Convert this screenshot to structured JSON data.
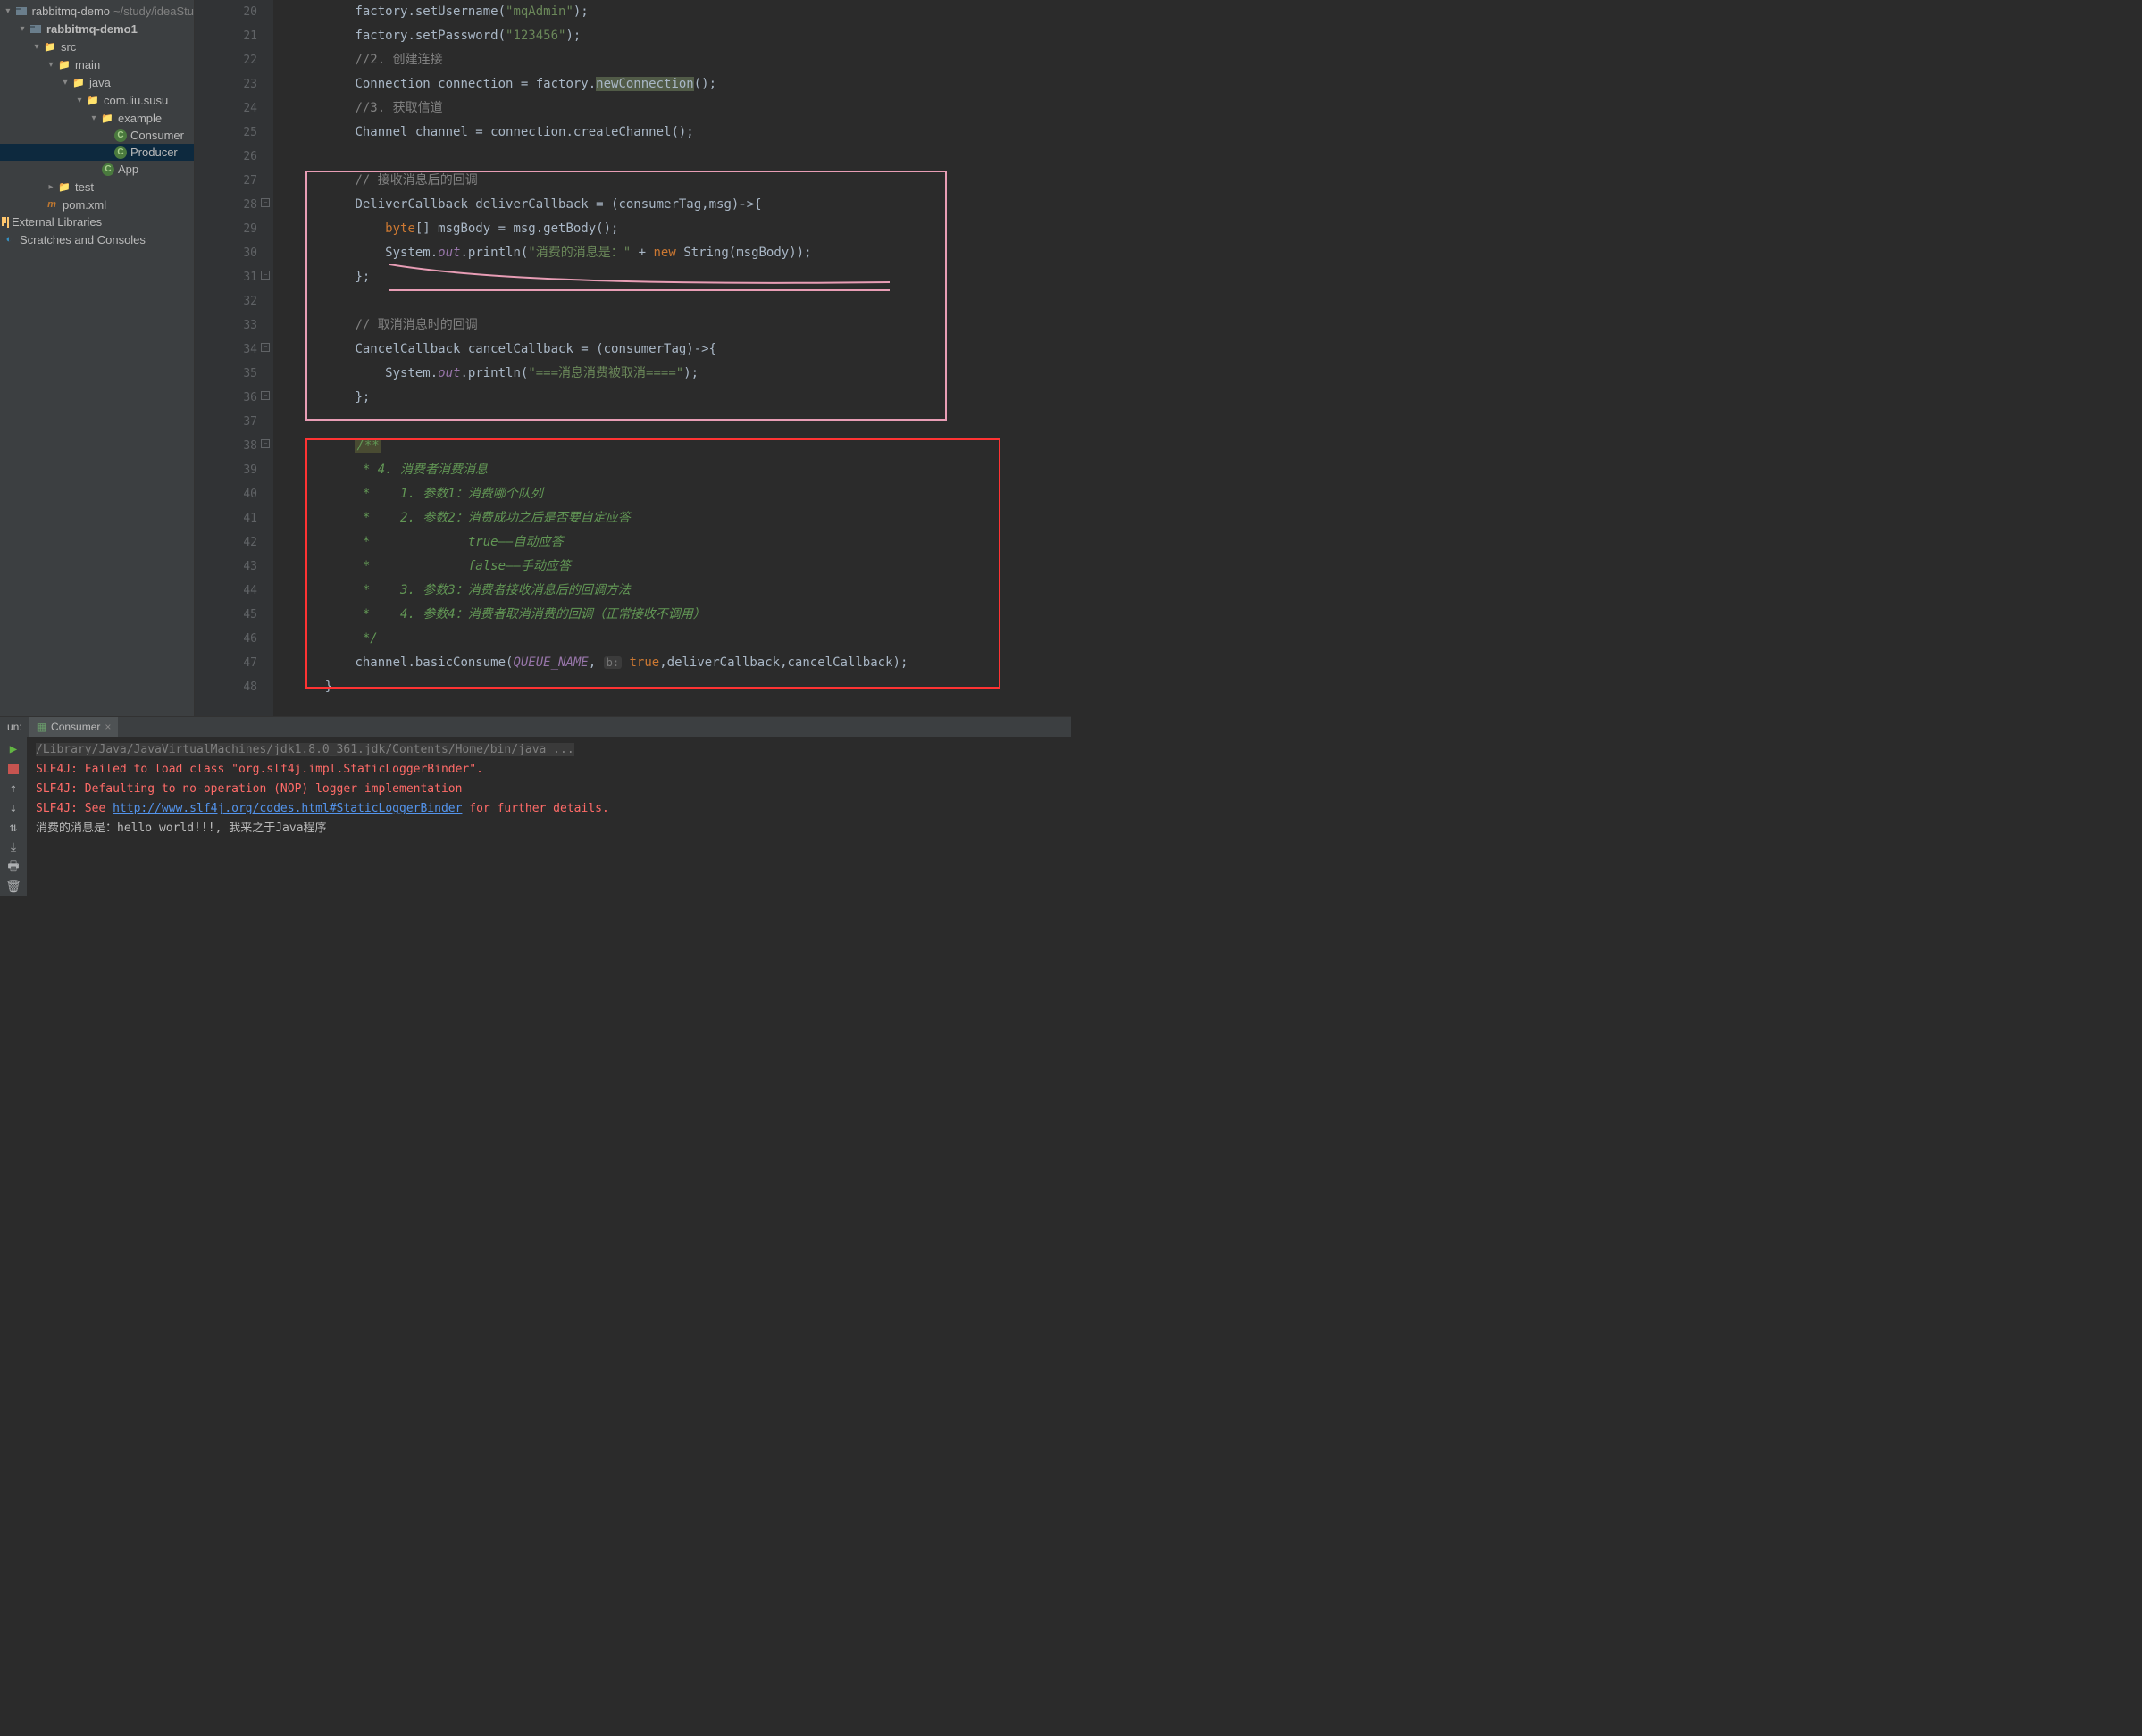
{
  "project": {
    "root": {
      "name": "rabbitmq-demo",
      "path": "~/study/ideaStu"
    },
    "module": "rabbitmq-demo1",
    "src": "src",
    "main": "main",
    "java": "java",
    "pkg": "com.liu.susu",
    "example": "example",
    "classes": {
      "consumer": "Consumer",
      "producer": "Producer",
      "app": "App"
    },
    "test": "test",
    "pom": "pom.xml",
    "extlib": "External Libraries",
    "scratches": "Scratches and Consoles"
  },
  "gutter": {
    "start": 20,
    "end": 48
  },
  "code": {
    "l20a": "factory.setUsername(",
    "l20b": "\"mqAdmin\"",
    "l20c": ");",
    "l21a": "factory.setPassword(",
    "l21b": "\"123456\"",
    "l21c": ");",
    "l22": "//2. 创建连接",
    "l23a": "Connection connection = factory.",
    "l23b": "newConnection",
    "l23c": "();",
    "l24": "//3. 获取信道",
    "l25": "Channel channel = connection.createChannel();",
    "l27": "// 接收消息后的回调",
    "l28": "DeliverCallback deliverCallback = (consumerTag,msg)->{",
    "l29a": "byte",
    "l29b": "[] msgBody = msg.getBody();",
    "l30a": "System.",
    "l30b": "out",
    "l30c": ".println(",
    "l30d": "\"消费的消息是：\"",
    "l30e": " + ",
    "l30f": "new",
    "l30g": " String(msgBody));",
    "l31": "};",
    "l33": "// 取消消息时的回调",
    "l34": "CancelCallback cancelCallback = (consumerTag)->{",
    "l35a": "System.",
    "l35b": "out",
    "l35c": ".println(",
    "l35d": "\"===消息消费被取消====\"",
    "l35e": ");",
    "l36": "};",
    "l38": "/**",
    "l39": " * 4. 消费者消费消息",
    "l40": " *    1. 参数1：消费哪个队列",
    "l41": " *    2. 参数2：消费成功之后是否要自定应答",
    "l42": " *             true——自动应答",
    "l43": " *             false——手动应答",
    "l44": " *    3. 参数3：消费者接收消息后的回调方法",
    "l45": " *    4. 参数4：消费者取消消费的回调（正常接收不调用）",
    "l46": " */",
    "l47a": "channel.basicConsume(",
    "l47b": "QUEUE_NAME",
    "l47c": ", ",
    "l47hint": "b:",
    "l47d": " true",
    "l47e": ",deliverCallback,cancelCallback);",
    "l48": "}"
  },
  "run": {
    "tabLabel": "un:",
    "tab": "Consumer",
    "cmd": "/Library/Java/JavaVirtualMachines/jdk1.8.0_361.jdk/Contents/Home/bin/java ...",
    "err1": "SLF4J: Failed to load class \"org.slf4j.impl.StaticLoggerBinder\".",
    "err2": "SLF4J: Defaulting to no-operation (NOP) logger implementation",
    "err3a": "SLF4J: See ",
    "err3link": "http://www.slf4j.org/codes.html#StaticLoggerBinder",
    "err3b": " for further details.",
    "out": "消费的消息是：hello world!!!, 我来之于Java程序"
  }
}
